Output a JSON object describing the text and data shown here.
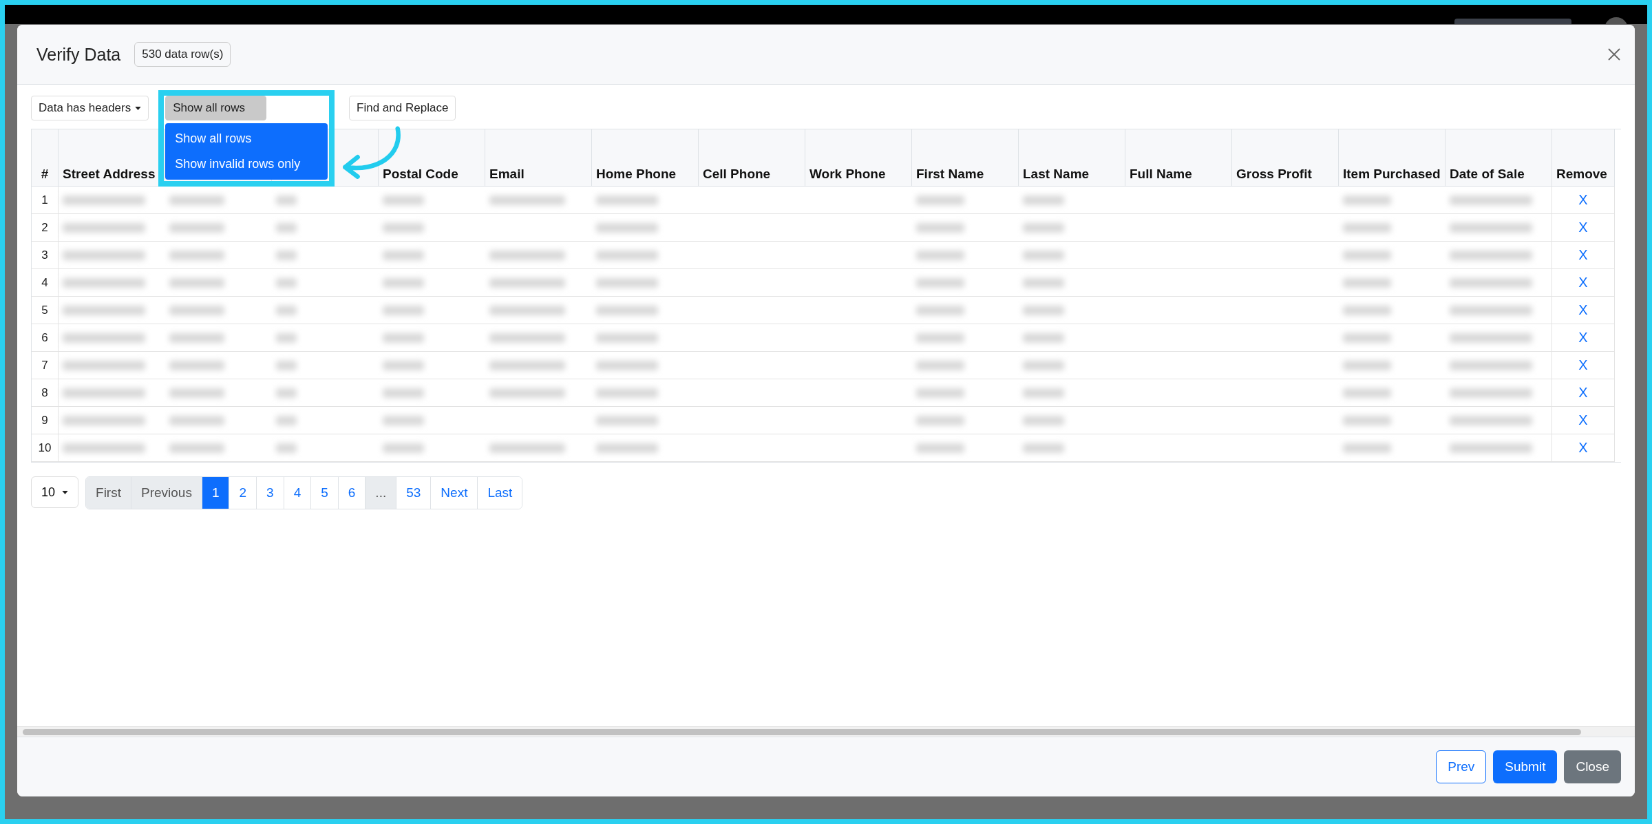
{
  "modal": {
    "title": "Verify Data",
    "badge": "530 data row(s)"
  },
  "toolbar": [
    {
      "label": "Data has headers",
      "kind": "dropdown"
    },
    {
      "label": "Show all rows",
      "kind": "open"
    },
    {
      "label": "Find and Replace",
      "kind": "plain"
    }
  ],
  "row_filter_menu": [
    {
      "label": "Show all rows",
      "selected": true
    },
    {
      "label": "Show invalid rows only",
      "selected": true
    }
  ],
  "table": {
    "columns": [
      {
        "label": "#"
      },
      {
        "label": "Street Address"
      },
      {},
      {},
      {
        "label": "Postal Code"
      },
      {
        "label": "Email"
      },
      {
        "label": "Home Phone"
      },
      {
        "label": "Cell Phone"
      },
      {
        "label": "Work Phone"
      },
      {
        "label": "First Name"
      },
      {
        "label": "Last Name"
      },
      {
        "label": "Full Name"
      },
      {
        "label": "Gross Profit"
      },
      {
        "label": "Item Purchased"
      },
      {
        "label": "Date of Sale"
      },
      {
        "label": "Remove"
      }
    ],
    "rows": [
      {
        "number": "1",
        "cells": [
          true,
          true,
          true,
          true,
          true,
          true,
          false,
          false,
          true,
          true,
          false,
          false,
          true,
          true
        ],
        "remove": "X"
      },
      {
        "number": "2",
        "cells": [
          true,
          true,
          true,
          true,
          false,
          true,
          false,
          false,
          true,
          true,
          false,
          false,
          true,
          true
        ],
        "remove": "X"
      },
      {
        "number": "3",
        "cells": [
          true,
          true,
          true,
          true,
          true,
          true,
          false,
          false,
          true,
          true,
          false,
          false,
          true,
          true
        ],
        "remove": "X"
      },
      {
        "number": "4",
        "cells": [
          true,
          true,
          true,
          true,
          true,
          true,
          false,
          false,
          true,
          true,
          false,
          false,
          true,
          true
        ],
        "remove": "X"
      },
      {
        "number": "5",
        "cells": [
          true,
          true,
          true,
          true,
          true,
          true,
          false,
          false,
          true,
          true,
          false,
          false,
          true,
          true
        ],
        "remove": "X"
      },
      {
        "number": "6",
        "cells": [
          true,
          true,
          true,
          true,
          true,
          true,
          false,
          false,
          true,
          true,
          false,
          false,
          true,
          true
        ],
        "remove": "X"
      },
      {
        "number": "7",
        "cells": [
          true,
          true,
          true,
          true,
          true,
          true,
          false,
          false,
          true,
          true,
          false,
          false,
          true,
          true
        ],
        "remove": "X"
      },
      {
        "number": "8",
        "cells": [
          true,
          true,
          true,
          true,
          true,
          true,
          false,
          false,
          true,
          true,
          false,
          false,
          true,
          true
        ],
        "remove": "X"
      },
      {
        "number": "9",
        "cells": [
          true,
          true,
          true,
          true,
          false,
          true,
          false,
          false,
          true,
          true,
          false,
          false,
          true,
          true
        ],
        "remove": "X"
      },
      {
        "number": "10",
        "cells": [
          true,
          true,
          true,
          true,
          true,
          true,
          false,
          false,
          true,
          true,
          false,
          false,
          true,
          true
        ],
        "remove": "X"
      }
    ]
  },
  "pagination": {
    "page_size": "10",
    "pages": [
      {
        "label": "First",
        "selected": false,
        "disabled": true
      },
      {
        "label": "Previous",
        "selected": false,
        "disabled": true
      },
      {
        "label": "1",
        "selected": true,
        "disabled": false
      },
      {
        "label": "2",
        "selected": false,
        "disabled": false
      },
      {
        "label": "3",
        "selected": false,
        "disabled": false
      },
      {
        "label": "4",
        "selected": false,
        "disabled": false
      },
      {
        "label": "5",
        "selected": false,
        "disabled": false
      },
      {
        "label": "6",
        "selected": false,
        "disabled": false
      },
      {
        "label": "...",
        "selected": false,
        "disabled": true
      },
      {
        "label": "53",
        "selected": false,
        "disabled": false
      },
      {
        "label": "Next",
        "selected": false,
        "disabled": false
      },
      {
        "label": "Last",
        "selected": false,
        "disabled": false
      }
    ]
  },
  "footer_buttons": [
    {
      "label": "Prev",
      "kind": "outline"
    },
    {
      "label": "Submit",
      "kind": "primary"
    },
    {
      "label": "Close",
      "kind": "secondary"
    }
  ]
}
